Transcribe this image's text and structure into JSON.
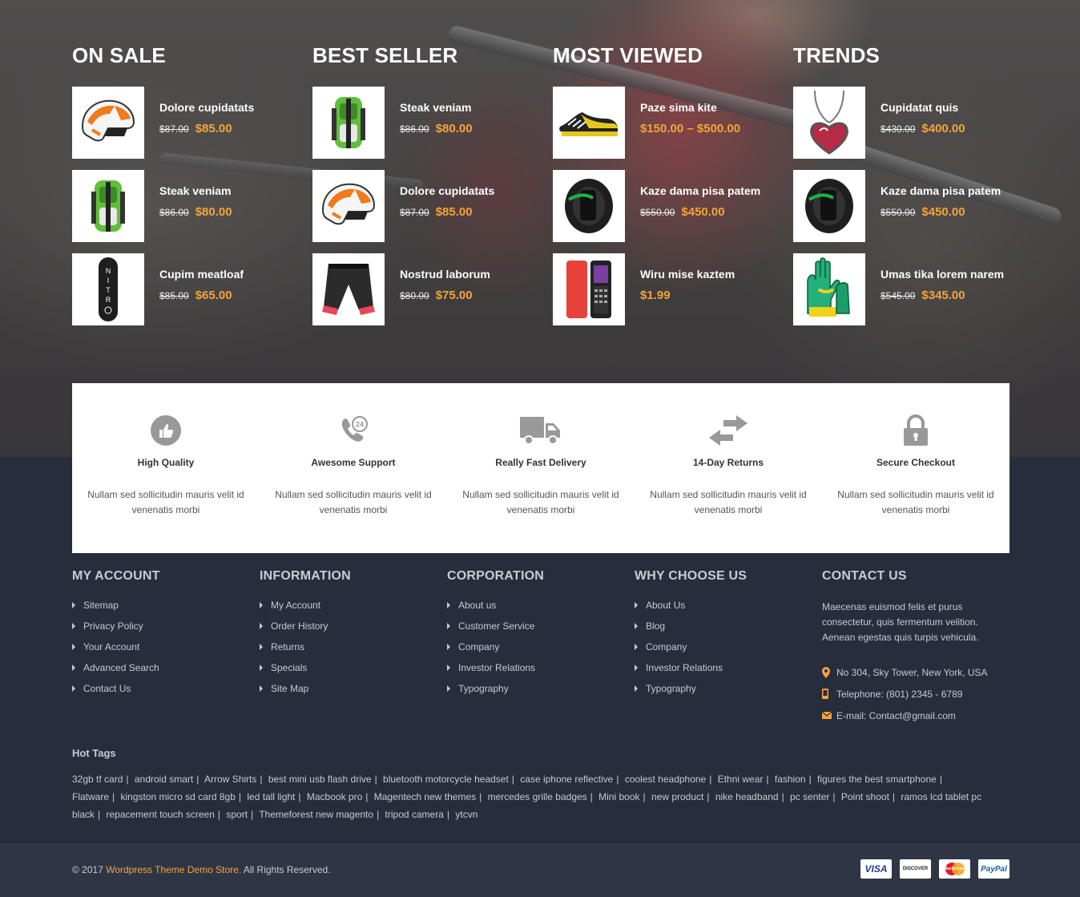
{
  "columns": [
    {
      "title": "ON SALE",
      "products": [
        {
          "name": "Dolore cupidatats",
          "old_price": "$87.00",
          "price": "$85.00",
          "image": "helmet"
        },
        {
          "name": "Steak veniam",
          "old_price": "$86.00",
          "price": "$80.00",
          "image": "backpack"
        },
        {
          "name": "Cupim meatloaf",
          "old_price": "$85.00",
          "price": "$65.00",
          "image": "snowboard"
        }
      ]
    },
    {
      "title": "BEST SELLER",
      "products": [
        {
          "name": "Steak veniam",
          "old_price": "$86.00",
          "price": "$80.00",
          "image": "backpack"
        },
        {
          "name": "Dolore cupidatats",
          "old_price": "$87.00",
          "price": "$85.00",
          "image": "helmet"
        },
        {
          "name": "Nostrud laborum",
          "old_price": "$80.00",
          "price": "$75.00",
          "image": "shorts"
        }
      ]
    },
    {
      "title": "MOST VIEWED",
      "products": [
        {
          "name": "Paze sima kite",
          "old_price": "",
          "price": "$150.00 – $500.00",
          "image": "shoe"
        },
        {
          "name": "Kaze dama pisa patem",
          "old_price": "$550.00",
          "price": "$450.00",
          "image": "watch"
        },
        {
          "name": "Wiru mise kaztem",
          "old_price": "",
          "price": "$1.99",
          "image": "phone"
        }
      ]
    },
    {
      "title": "TRENDS",
      "products": [
        {
          "name": "Cupidatat quis",
          "old_price": "$430.00",
          "price": "$400.00",
          "image": "necklace"
        },
        {
          "name": "Kaze dama pisa patem",
          "old_price": "$550.00",
          "price": "$450.00",
          "image": "watch"
        },
        {
          "name": "Umas tika lorem narem",
          "old_price": "$545.00",
          "price": "$345.00",
          "image": "gloves"
        }
      ]
    }
  ],
  "features": [
    {
      "title": "High Quality",
      "desc": "Nullam sed sollicitudin mauris velit id venenatis morbi",
      "icon": "thumbs-up-icon"
    },
    {
      "title": "Awesome Support",
      "desc": "Nullam sed sollicitudin mauris velit id venenatis morbi",
      "icon": "support-24-icon"
    },
    {
      "title": "Really Fast Delivery",
      "desc": "Nullam sed sollicitudin mauris velit id venenatis morbi",
      "icon": "truck-icon"
    },
    {
      "title": "14-Day Returns",
      "desc": "Nullam sed sollicitudin mauris velit id venenatis morbi",
      "icon": "exchange-arrows-icon"
    },
    {
      "title": "Secure Checkout",
      "desc": "Nullam sed sollicitudin mauris velit id venenatis morbi",
      "icon": "lock-icon"
    }
  ],
  "footer": {
    "my_account": {
      "title": "MY ACCOUNT",
      "items": [
        "Sitemap",
        "Privacy Policy",
        "Your Account",
        "Advanced Search",
        "Contact Us"
      ]
    },
    "information": {
      "title": "INFORMATION",
      "items": [
        "My Account",
        "Order History",
        "Returns",
        "Specials",
        "Site Map"
      ]
    },
    "corporation": {
      "title": "CORPORATION",
      "items": [
        "About us",
        "Customer Service",
        "Company",
        "Investor Relations",
        "Typography"
      ]
    },
    "why_choose_us": {
      "title": "WHY CHOOSE US",
      "items": [
        "About Us",
        "Blog",
        "Company",
        "Investor Relations",
        "Typography"
      ]
    },
    "contact": {
      "title": "CONTACT US",
      "text": "Maecenas euismod felis et purus consectetur, quis fermentum velition. Aenean egestas quis turpis vehicula.",
      "address": "No 304, Sky Tower, New York, USA",
      "phone": "Telephone: (801) 2345 - 6789",
      "email": "E-mail: Contact@gmail.com"
    }
  },
  "hot_tags": {
    "title": "Hot Tags",
    "tags": [
      "32gb tf card",
      "android smart",
      "Arrow Shirts",
      "best mini usb flash drive",
      "bluetooth motorcycle headset",
      "case iphone reflective",
      "coolest headphone",
      "Ethni wear",
      "fashion",
      "figures the best smartphone",
      "Flatware",
      "kingston micro sd card 8gb",
      "led tall light",
      "Macbook pro",
      "Magentech new themes",
      "mercedes grille badges",
      "Mini book",
      "new product",
      "nike headband",
      "pc senter",
      "Point shoot",
      "ramos lcd tablet pc black",
      "repacement touch screen",
      "sport",
      "Themeforest new magento",
      "tripod camera",
      "ytcvn"
    ]
  },
  "bottom": {
    "copy_prefix": "© 2017 ",
    "brand": "Wordpress Theme Demo Store.",
    "copy_suffix": " All Rights Reserved.",
    "payments": [
      "VISA",
      "DISCOVER",
      "MasterCard",
      "PayPal"
    ]
  },
  "colors": {
    "accent": "#f4a43a",
    "footer_bg": "#262d3c",
    "bottom_bg": "#2e3646"
  }
}
